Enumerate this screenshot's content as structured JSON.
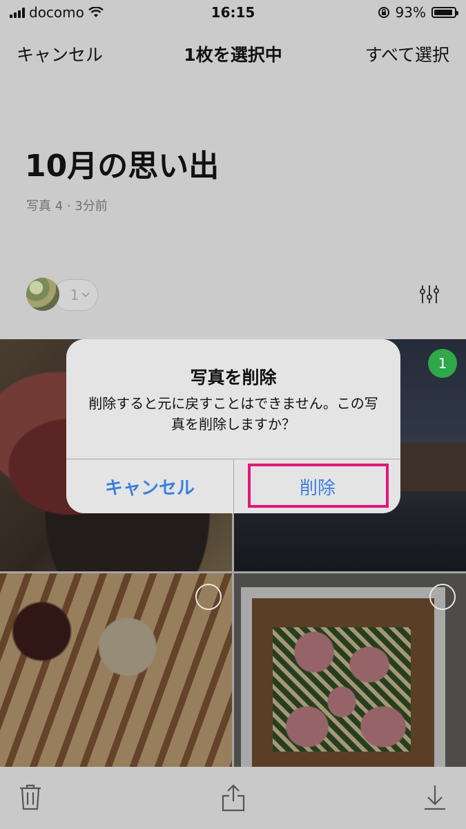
{
  "status_bar": {
    "carrier": "docomo",
    "time": "16:15",
    "battery": "93%",
    "battery_level": 0.93
  },
  "nav": {
    "cancel": "キャンセル",
    "title": "1枚を選択中",
    "select_all": "すべて選択"
  },
  "album": {
    "title": "10月の思い出",
    "meta": "写真 4 · 3分前",
    "member_count": "1"
  },
  "photos": [
    {
      "selected": true,
      "badge": "1"
    },
    {
      "selected": false
    },
    {
      "selected": false
    },
    {
      "selected": false
    }
  ],
  "alert": {
    "title": "写真を削除",
    "message": "削除すると元に戻すことはできません。この写真を削除しますか？",
    "cancel": "キャンセル",
    "delete": "削除"
  },
  "colors": {
    "accent_blue": "#3d7fe0",
    "selected_green": "#2fa84a",
    "highlight": "#e0177a"
  }
}
